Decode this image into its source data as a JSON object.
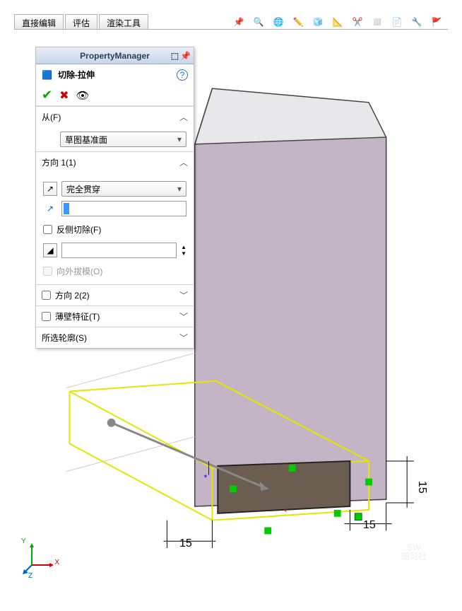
{
  "tabs": [
    "直接编辑",
    "评估",
    "渲染工具"
  ],
  "panel": {
    "title": "PropertyManager",
    "feature": "切除-拉伸",
    "from": {
      "label": "从(F)",
      "value": "草图基准面"
    },
    "dir1": {
      "label": "方向 1(1)",
      "endcond": "完全贯穿",
      "flip_cut": "反侧切除(F)",
      "draft_out": "向外拔模(O)"
    },
    "dir2": "方向 2(2)",
    "thin": "薄壁特征(T)",
    "contour": "所选轮廓(S)"
  },
  "dims": {
    "d1": "15",
    "d2": "15",
    "d3": "15"
  },
  "watermark": {
    "l1": "SW",
    "l2": "研习社"
  },
  "triad": {
    "x": "X",
    "y": "Y",
    "z": "Z"
  }
}
